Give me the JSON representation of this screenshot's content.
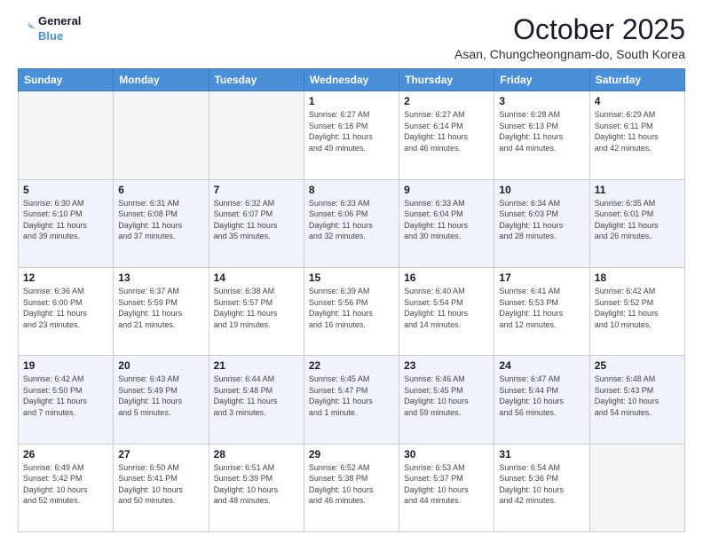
{
  "header": {
    "logo_line1": "General",
    "logo_line2": "Blue",
    "title": "October 2025",
    "subtitle": "Asan, Chungcheongnam-do, South Korea"
  },
  "days_of_week": [
    "Sunday",
    "Monday",
    "Tuesday",
    "Wednesday",
    "Thursday",
    "Friday",
    "Saturday"
  ],
  "weeks": [
    [
      {
        "day": "",
        "info": ""
      },
      {
        "day": "",
        "info": ""
      },
      {
        "day": "",
        "info": ""
      },
      {
        "day": "1",
        "info": "Sunrise: 6:27 AM\nSunset: 6:16 PM\nDaylight: 11 hours\nand 49 minutes."
      },
      {
        "day": "2",
        "info": "Sunrise: 6:27 AM\nSunset: 6:14 PM\nDaylight: 11 hours\nand 46 minutes."
      },
      {
        "day": "3",
        "info": "Sunrise: 6:28 AM\nSunset: 6:13 PM\nDaylight: 11 hours\nand 44 minutes."
      },
      {
        "day": "4",
        "info": "Sunrise: 6:29 AM\nSunset: 6:11 PM\nDaylight: 11 hours\nand 42 minutes."
      }
    ],
    [
      {
        "day": "5",
        "info": "Sunrise: 6:30 AM\nSunset: 6:10 PM\nDaylight: 11 hours\nand 39 minutes."
      },
      {
        "day": "6",
        "info": "Sunrise: 6:31 AM\nSunset: 6:08 PM\nDaylight: 11 hours\nand 37 minutes."
      },
      {
        "day": "7",
        "info": "Sunrise: 6:32 AM\nSunset: 6:07 PM\nDaylight: 11 hours\nand 35 minutes."
      },
      {
        "day": "8",
        "info": "Sunrise: 6:33 AM\nSunset: 6:06 PM\nDaylight: 11 hours\nand 32 minutes."
      },
      {
        "day": "9",
        "info": "Sunrise: 6:33 AM\nSunset: 6:04 PM\nDaylight: 11 hours\nand 30 minutes."
      },
      {
        "day": "10",
        "info": "Sunrise: 6:34 AM\nSunset: 6:03 PM\nDaylight: 11 hours\nand 28 minutes."
      },
      {
        "day": "11",
        "info": "Sunrise: 6:35 AM\nSunset: 6:01 PM\nDaylight: 11 hours\nand 26 minutes."
      }
    ],
    [
      {
        "day": "12",
        "info": "Sunrise: 6:36 AM\nSunset: 6:00 PM\nDaylight: 11 hours\nand 23 minutes."
      },
      {
        "day": "13",
        "info": "Sunrise: 6:37 AM\nSunset: 5:59 PM\nDaylight: 11 hours\nand 21 minutes."
      },
      {
        "day": "14",
        "info": "Sunrise: 6:38 AM\nSunset: 5:57 PM\nDaylight: 11 hours\nand 19 minutes."
      },
      {
        "day": "15",
        "info": "Sunrise: 6:39 AM\nSunset: 5:56 PM\nDaylight: 11 hours\nand 16 minutes."
      },
      {
        "day": "16",
        "info": "Sunrise: 6:40 AM\nSunset: 5:54 PM\nDaylight: 11 hours\nand 14 minutes."
      },
      {
        "day": "17",
        "info": "Sunrise: 6:41 AM\nSunset: 5:53 PM\nDaylight: 11 hours\nand 12 minutes."
      },
      {
        "day": "18",
        "info": "Sunrise: 6:42 AM\nSunset: 5:52 PM\nDaylight: 11 hours\nand 10 minutes."
      }
    ],
    [
      {
        "day": "19",
        "info": "Sunrise: 6:42 AM\nSunset: 5:50 PM\nDaylight: 11 hours\nand 7 minutes."
      },
      {
        "day": "20",
        "info": "Sunrise: 6:43 AM\nSunset: 5:49 PM\nDaylight: 11 hours\nand 5 minutes."
      },
      {
        "day": "21",
        "info": "Sunrise: 6:44 AM\nSunset: 5:48 PM\nDaylight: 11 hours\nand 3 minutes."
      },
      {
        "day": "22",
        "info": "Sunrise: 6:45 AM\nSunset: 5:47 PM\nDaylight: 11 hours\nand 1 minute."
      },
      {
        "day": "23",
        "info": "Sunrise: 6:46 AM\nSunset: 5:45 PM\nDaylight: 10 hours\nand 59 minutes."
      },
      {
        "day": "24",
        "info": "Sunrise: 6:47 AM\nSunset: 5:44 PM\nDaylight: 10 hours\nand 56 minutes."
      },
      {
        "day": "25",
        "info": "Sunrise: 6:48 AM\nSunset: 5:43 PM\nDaylight: 10 hours\nand 54 minutes."
      }
    ],
    [
      {
        "day": "26",
        "info": "Sunrise: 6:49 AM\nSunset: 5:42 PM\nDaylight: 10 hours\nand 52 minutes."
      },
      {
        "day": "27",
        "info": "Sunrise: 6:50 AM\nSunset: 5:41 PM\nDaylight: 10 hours\nand 50 minutes."
      },
      {
        "day": "28",
        "info": "Sunrise: 6:51 AM\nSunset: 5:39 PM\nDaylight: 10 hours\nand 48 minutes."
      },
      {
        "day": "29",
        "info": "Sunrise: 6:52 AM\nSunset: 5:38 PM\nDaylight: 10 hours\nand 46 minutes."
      },
      {
        "day": "30",
        "info": "Sunrise: 6:53 AM\nSunset: 5:37 PM\nDaylight: 10 hours\nand 44 minutes."
      },
      {
        "day": "31",
        "info": "Sunrise: 6:54 AM\nSunset: 5:36 PM\nDaylight: 10 hours\nand 42 minutes."
      },
      {
        "day": "",
        "info": ""
      }
    ]
  ]
}
